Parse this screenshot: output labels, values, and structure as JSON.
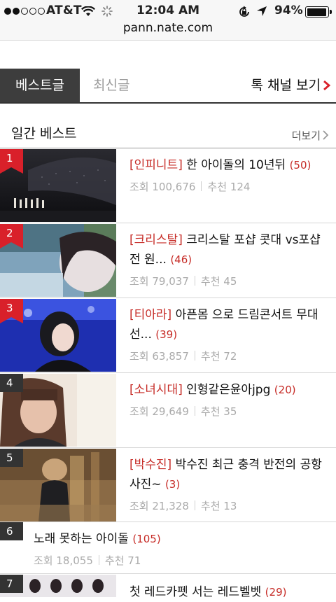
{
  "status_bar": {
    "carrier": "AT&T",
    "time": "12:04 AM",
    "battery_pct": "94%",
    "battery_level": 0.94,
    "signal_bars_filled": 2,
    "signal_bars_total": 5,
    "url": "pann.nate.com"
  },
  "tabs": {
    "best": "베스트글",
    "new": "최신글",
    "channel": "톡 채널 보기"
  },
  "section": {
    "title": "일간 베스트",
    "more": "더보기"
  },
  "colors": {
    "accent_red": "#d9202a",
    "tag_red": "#c62b26",
    "rank_dark": "#333333"
  },
  "items": [
    {
      "rank": "1",
      "tag": "[인피니트]",
      "title": " 한 아이돌의 10년뒤",
      "comments": "(50)",
      "views_label": "조회",
      "views": "100,676",
      "recs_label": "추천",
      "recs": "124"
    },
    {
      "rank": "2",
      "tag": "[크리스탈]",
      "title": " 크리스탈 포샵 콧대 vs포샵 전 원...",
      "comments": "(46)",
      "views_label": "조회",
      "views": "79,037",
      "recs_label": "추천",
      "recs": "45"
    },
    {
      "rank": "3",
      "tag": "[티아라]",
      "title": " 아픈몸 으로 드림콘서트 무대 선...",
      "comments": "(39)",
      "views_label": "조회",
      "views": "63,857",
      "recs_label": "추천",
      "recs": "72"
    },
    {
      "rank": "4",
      "tag": "[소녀시대]",
      "title": " 인형같은윤아jpg",
      "comments": "(20)",
      "views_label": "조회",
      "views": "29,649",
      "recs_label": "추천",
      "recs": "35"
    },
    {
      "rank": "5",
      "tag": "[박수진]",
      "title": " 박수진 최근 충격 반전의 공항 사진~",
      "comments": "(3)",
      "views_label": "조회",
      "views": "21,328",
      "recs_label": "추천",
      "recs": "13"
    },
    {
      "rank": "6",
      "tag": "",
      "title": "노래 못하는 아이돌",
      "comments": "(105)",
      "views_label": "조회",
      "views": "18,055",
      "recs_label": "추천",
      "recs": "71"
    },
    {
      "rank": "7",
      "tag": "",
      "title": "첫 레드카펫 서는 레드벨벳",
      "comments": "(29)",
      "views_label": "",
      "views": "",
      "recs_label": "",
      "recs": ""
    }
  ]
}
